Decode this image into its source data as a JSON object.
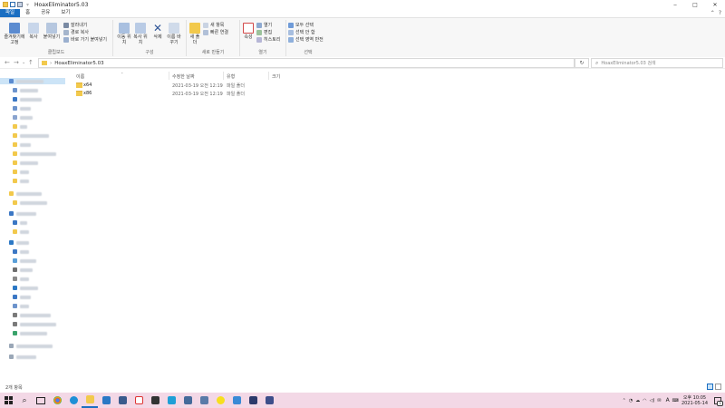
{
  "window": {
    "title": "HoaxEliminator5.03",
    "controls": {
      "minimize": "‒",
      "maximize": "□",
      "close": "✕"
    }
  },
  "ribbon_tabs": [
    {
      "label": "파일",
      "active": true
    },
    {
      "label": "홈",
      "active": false
    },
    {
      "label": "공유",
      "active": false
    },
    {
      "label": "보기",
      "active": false
    }
  ],
  "ribbon": {
    "clipboard": {
      "label": "클립보드",
      "pin": "즐겨찾기에 고정",
      "copy": "복사",
      "paste": "붙여넣기",
      "cut": "잘라내기",
      "copy_path": "경로 복사",
      "paste_shortcut": "바로 가기 붙여넣기"
    },
    "organize": {
      "label": "구성",
      "move_to": "이동 위치",
      "copy_to": "복사 위치",
      "delete": "삭제",
      "rename": "이름 바꾸기"
    },
    "new": {
      "label": "새로 만들기",
      "new_folder": "새 폴더",
      "new_item": "새 항목",
      "easy_access": "빠른 연결"
    },
    "open": {
      "label": "열기",
      "properties": "속성",
      "open": "열기",
      "edit": "편집",
      "history": "히스토리"
    },
    "select": {
      "label": "선택",
      "select_all": "모두 선택",
      "select_none": "선택 안 함",
      "invert": "선택 영역 반전"
    }
  },
  "address": {
    "breadcrumb": "HoaxEliminator5.03",
    "search_placeholder": "HoaxEliminator5.03 검색"
  },
  "columns": {
    "name": "이름",
    "modified": "수정한 날짜",
    "type": "유형",
    "size": "크기"
  },
  "files": [
    {
      "name": "x64",
      "modified": "2021-03-19 오전 12:19",
      "type": "파일 폴더"
    },
    {
      "name": "x86",
      "modified": "2021-03-19 오전 12:19",
      "type": "파일 폴더"
    }
  ],
  "status": {
    "item_count": "2개 항목"
  },
  "clock": {
    "time": "오후 10:05",
    "date": "2021-05-14"
  },
  "tray": {
    "ime": "A",
    "notifications": "1"
  },
  "colors": {
    "accent": "#1a6ec2",
    "taskbar": "#f3d8e6",
    "folder": "#f2c94c"
  }
}
